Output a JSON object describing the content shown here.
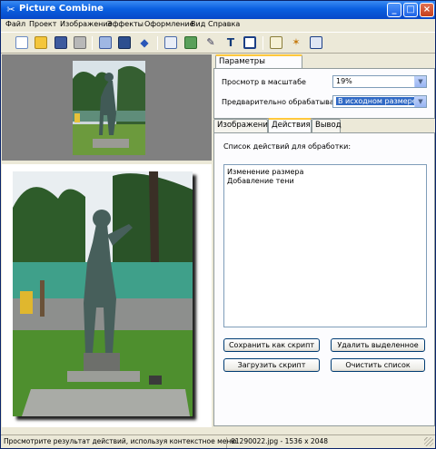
{
  "window": {
    "title": "Picture Combine",
    "controls": {
      "minimize": "_",
      "maximize": "□",
      "close": "×"
    }
  },
  "menu": [
    "Файл",
    "Проект",
    "Изображение",
    "Эффекты",
    "Оформление",
    "Вид",
    "Справка"
  ],
  "toolbar": {
    "icons": [
      "new-icon",
      "open-icon",
      "save-icon",
      "print-icon",
      "copy-icon",
      "export-icon",
      "add-icon",
      "page-icon",
      "image-icon",
      "brush-icon",
      "text-icon",
      "frame-icon",
      "edit-icon",
      "effects-icon",
      "calc-icon"
    ]
  },
  "preview_settings": {
    "tab_label": "Параметры просмотра",
    "scale_label": "Просмотр в масштабе",
    "scale_value": "19%",
    "preprocess_label": "Предварительно обрабатывать",
    "preprocess_value": "В исходном размере"
  },
  "tabs": [
    "Изображения",
    "Действия",
    "Вывод"
  ],
  "actions": {
    "list_label": "Список действий для обработки:",
    "items": [
      "Изменение размера",
      "Добавление тени"
    ],
    "buttons": {
      "save_script": "Сохранить как скрипт",
      "delete_selected": "Удалить выделенное",
      "load_script": "Загрузить скрипт",
      "clear_list": "Очистить список"
    }
  },
  "status": {
    "hint": "Просмотрите результат действий, используя контекстное меню",
    "file_info": "01290022.jpg - 1536 x 2048"
  },
  "colors": {
    "title_bar": "#0a5fe0",
    "window_bg": "#ece9d8",
    "selection": "#316ac5",
    "tab_highlight": "#ffc83c"
  }
}
